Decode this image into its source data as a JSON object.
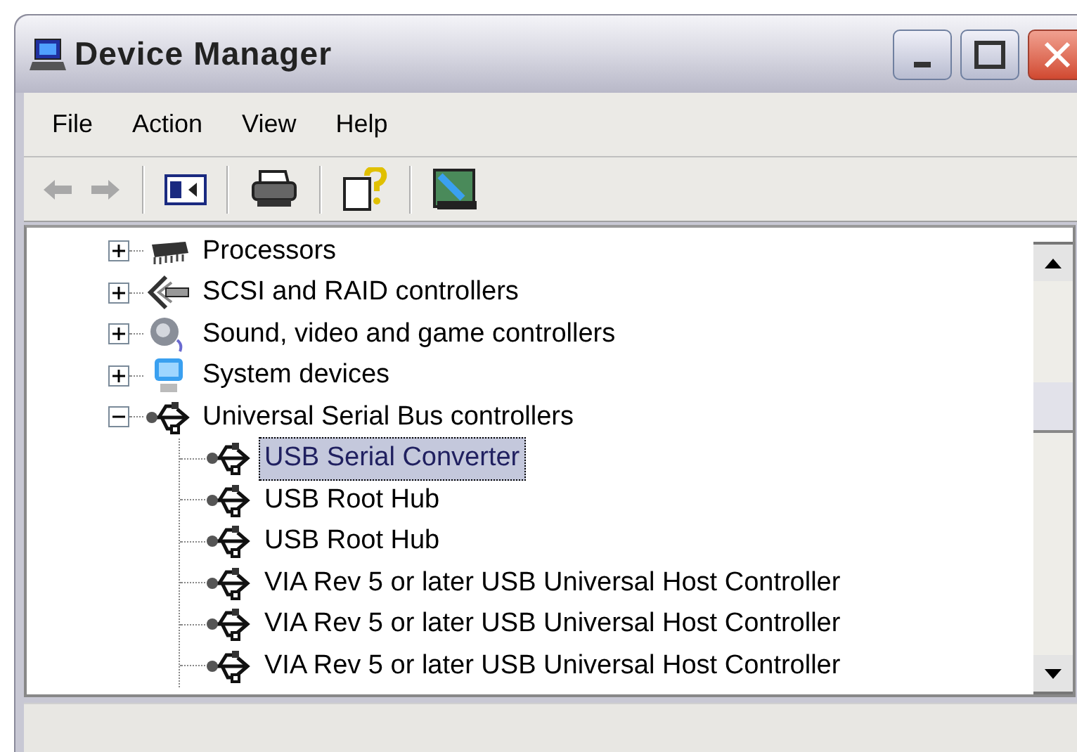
{
  "window": {
    "title": "Device Manager"
  },
  "menu": [
    "File",
    "Action",
    "View",
    "Help"
  ],
  "toolbar": [
    {
      "kind": "back",
      "disabled": true
    },
    {
      "kind": "forward",
      "disabled": true
    },
    {
      "kind": "sep"
    },
    {
      "kind": "pane",
      "disabled": false
    },
    {
      "kind": "sep"
    },
    {
      "kind": "print",
      "disabled": false
    },
    {
      "kind": "sep"
    },
    {
      "kind": "help",
      "disabled": false
    },
    {
      "kind": "sep"
    },
    {
      "kind": "scan",
      "disabled": false
    }
  ],
  "tree": [
    {
      "label": "Processors",
      "kind": "processor",
      "expanded": false
    },
    {
      "label": "SCSI and RAID controllers",
      "kind": "scsi",
      "expanded": false
    },
    {
      "label": "Sound, video and game controllers",
      "kind": "sound",
      "expanded": false
    },
    {
      "label": "System devices",
      "kind": "system",
      "expanded": false
    },
    {
      "label": "Universal Serial Bus controllers",
      "kind": "usb",
      "expanded": true,
      "children": [
        {
          "label": "USB Serial Converter",
          "selected": true
        },
        {
          "label": "USB Root Hub",
          "selected": false
        },
        {
          "label": "USB Root Hub",
          "selected": false
        },
        {
          "label": "VIA Rev 5 or later USB Universal Host Controller",
          "selected": false
        },
        {
          "label": "VIA Rev 5 or later USB Universal Host Controller",
          "selected": false
        },
        {
          "label": "VIA Rev 5 or later USB Universal Host Controller",
          "selected": false
        }
      ]
    }
  ]
}
